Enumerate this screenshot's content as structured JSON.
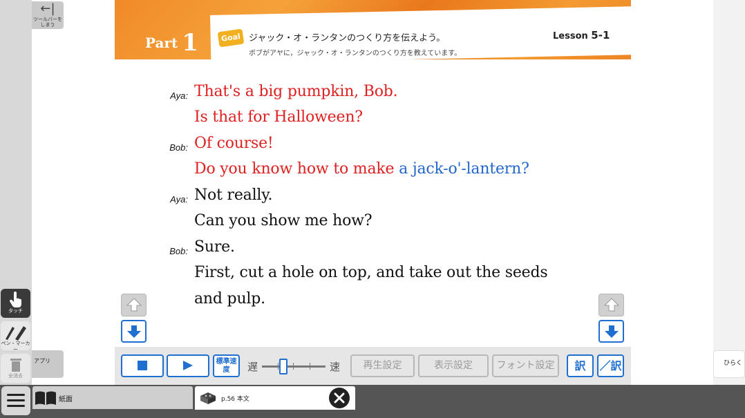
{
  "toolbar": {
    "hide_label": "ツールバーをしまう",
    "touch_label": "タッチ",
    "pen_label": "ペン・マーカー",
    "erase_label": "全消去",
    "app_label": "アプリ"
  },
  "header": {
    "part_word": "Part",
    "part_number": "1",
    "goal_badge": "Goal",
    "goal_text": "ジャック・オ・ランタンのつくり方を伝えよう。",
    "goal_sub": "ボブがアヤに，ジャック・オ・ランタンのつくり方を教えています。",
    "lesson_word": "Lesson",
    "lesson_number": "5-1"
  },
  "dialogue": [
    {
      "speaker": "Aya:",
      "text": "That's a big pumpkin, Bob.",
      "color": "#e02020"
    },
    {
      "speaker": "",
      "text": "Is that for Halloween?",
      "color": "#e02020"
    },
    {
      "speaker": "Bob:",
      "text": "Of course!",
      "color": "#e02020"
    },
    {
      "speaker": "",
      "text_red": "Do you know how to make",
      "text_blue": "a jack-o'-lantern?"
    },
    {
      "speaker": "Aya:",
      "text": "Not really.",
      "color": "#111111"
    },
    {
      "speaker": "",
      "text": "Can you show me how?",
      "color": "#111111"
    },
    {
      "speaker": "Bob:",
      "text": "Sure.",
      "color": "#111111"
    },
    {
      "speaker": "",
      "text": "First, cut a hole on top, and take out the seeds",
      "color": "#111111"
    },
    {
      "speaker": "",
      "text": "and pulp.",
      "color": "#111111"
    }
  ],
  "player": {
    "speed_label": "標準速度",
    "slow": "遅",
    "fast": "速",
    "speed_value": 0.35,
    "playback_settings": "再生設定",
    "display_settings": "表示設定",
    "font_settings": "フォント設定",
    "translation": "訳",
    "no_translation": "／訳"
  },
  "right": {
    "open_label": "ひらく"
  },
  "tabs": [
    {
      "label": "紙面"
    },
    {
      "label": "p.56 本文"
    }
  ],
  "colors": {
    "accent": "#1e6fd0",
    "red_text": "#e02020",
    "blue_text": "#2266cc",
    "banner_orange": "#f08a28"
  }
}
